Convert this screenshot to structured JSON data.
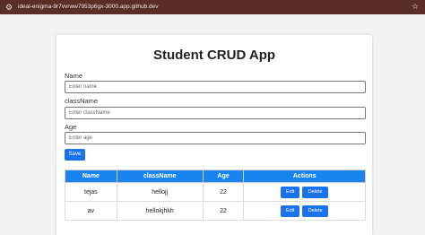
{
  "browser": {
    "url": "ideal-enigma-9r7vvrww7953p6gx-3000.app.github.dev"
  },
  "app": {
    "title": "Student CRUD App"
  },
  "form": {
    "name_label": "Name",
    "name_placeholder": "Enter name",
    "class_label": "className",
    "class_placeholder": "Enter className",
    "age_label": "Age",
    "age_placeholder": "Enter age",
    "save_label": "Save"
  },
  "table": {
    "headers": [
      "Name",
      "className",
      "Age",
      "Actions"
    ],
    "rows": [
      {
        "name": "tejas",
        "className": "hellojj",
        "age": "22"
      },
      {
        "name": "av",
        "className": "hellokjhkh",
        "age": "22"
      }
    ],
    "edit_label": "Edit",
    "delete_label": "Delete"
  },
  "colors": {
    "accent": "#1a73e8",
    "header": "#1a84ee",
    "browser_bar": "#5a2e26"
  }
}
